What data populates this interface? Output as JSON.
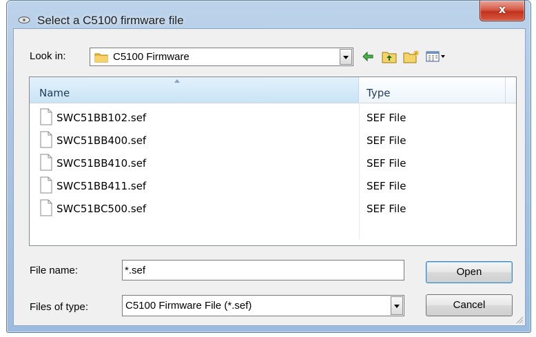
{
  "window": {
    "title": "Select a C5100 firmware file",
    "close_label": "x"
  },
  "lookin": {
    "label": "Look in:",
    "value": "C5100 Firmware"
  },
  "toolbar": {
    "icons": [
      "back-icon",
      "up-folder-icon",
      "new-folder-icon",
      "view-menu-icon"
    ]
  },
  "filelist": {
    "columns": {
      "name": "Name",
      "type": "Type"
    },
    "rows": [
      {
        "name": "SWC51BB102.sef",
        "type": "SEF File"
      },
      {
        "name": "SWC51BB400.sef",
        "type": "SEF File"
      },
      {
        "name": "SWC51BB410.sef",
        "type": "SEF File"
      },
      {
        "name": "SWC51BB411.sef",
        "type": "SEF File"
      },
      {
        "name": "SWC51BC500.sef",
        "type": "SEF File"
      }
    ]
  },
  "filename": {
    "label": "File name:",
    "value": "*.sef"
  },
  "filetype": {
    "label": "Files of type:",
    "value": "C5100 Firmware File (*.sef)"
  },
  "buttons": {
    "open": "Open",
    "cancel": "Cancel"
  },
  "colors": {
    "accent": "#3c7fb1",
    "close": "#c2321e",
    "frame": "#a9c5e4"
  }
}
